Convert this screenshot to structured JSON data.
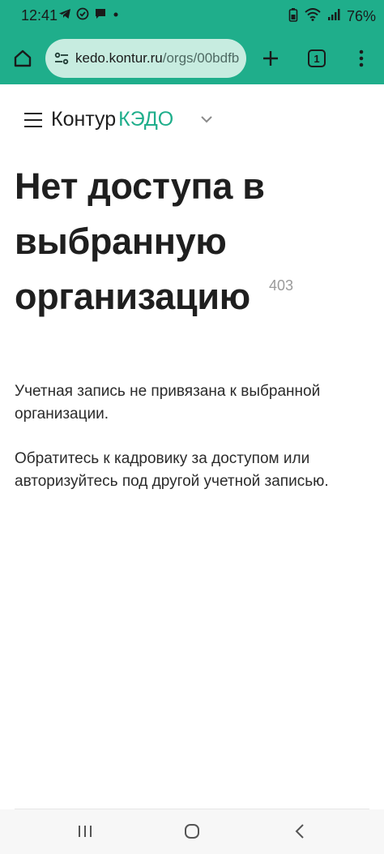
{
  "status_bar": {
    "time": "12:41",
    "battery": "76%",
    "left_icons": [
      "telegram-icon",
      "check-circle-icon",
      "chat-icon",
      "dot-icon"
    ],
    "right_icons": [
      "battery-saver-icon",
      "wifi-icon",
      "signal-icon"
    ]
  },
  "browser": {
    "url_host": "kedo.kontur.ru",
    "url_path": "/orgs/00bdfb",
    "tab_count": "1",
    "accent_color": "#1fae8b"
  },
  "site_header": {
    "brand": "Контур",
    "product": "КЭДО"
  },
  "content": {
    "title": "Нет доступа в выбранную организацию",
    "error_code": "403",
    "message_1": "Учетная запись не привязана к выбранной организации.",
    "message_2": "Обратитесь к кадровику за доступом или авторизуйтесь под другой учетной записью."
  }
}
